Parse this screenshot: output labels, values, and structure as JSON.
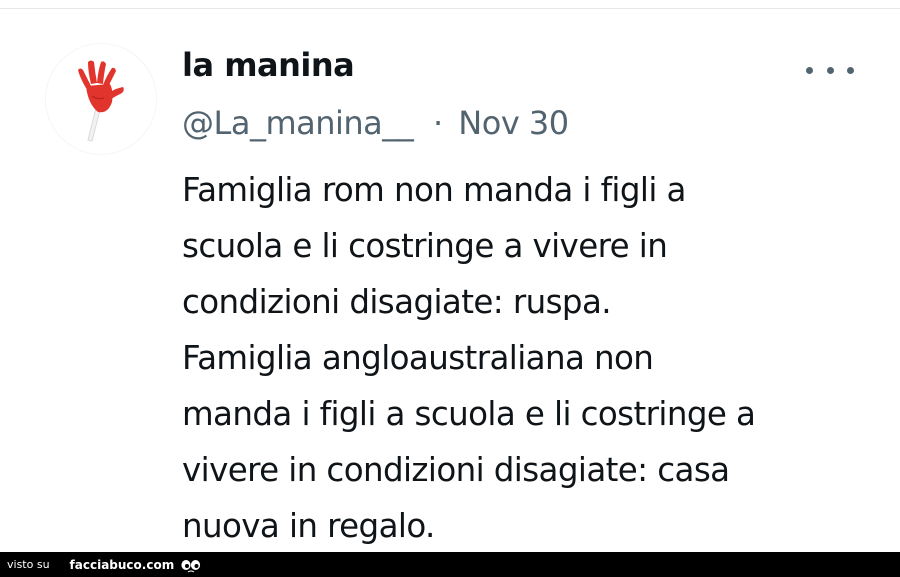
{
  "tweet": {
    "display_name": "la manina",
    "handle": "@La_manina__",
    "separator": "·",
    "date": "Nov 30",
    "more_icon": "more-horizontal-icon",
    "avatar_icon": "hand-clapper-icon",
    "text_lines": [
      "Famiglia rom non manda i figli a",
      "scuola e li costringe a vivere in",
      "condizioni disagiate: ruspa.",
      "Famiglia angloaustraliana non",
      "manda i figli a scuola e li costringe a",
      "vivere in condizioni disagiate: casa",
      "nuova in regalo."
    ]
  },
  "footer": {
    "seen_label": "visto su",
    "site_label": "facciabuco.com",
    "logo_icon": "eyes-icon"
  },
  "colors": {
    "text": "#0f1419",
    "secondary_text": "#536471",
    "avatar_hand": "#e0342c",
    "footer_bg": "#000000"
  }
}
